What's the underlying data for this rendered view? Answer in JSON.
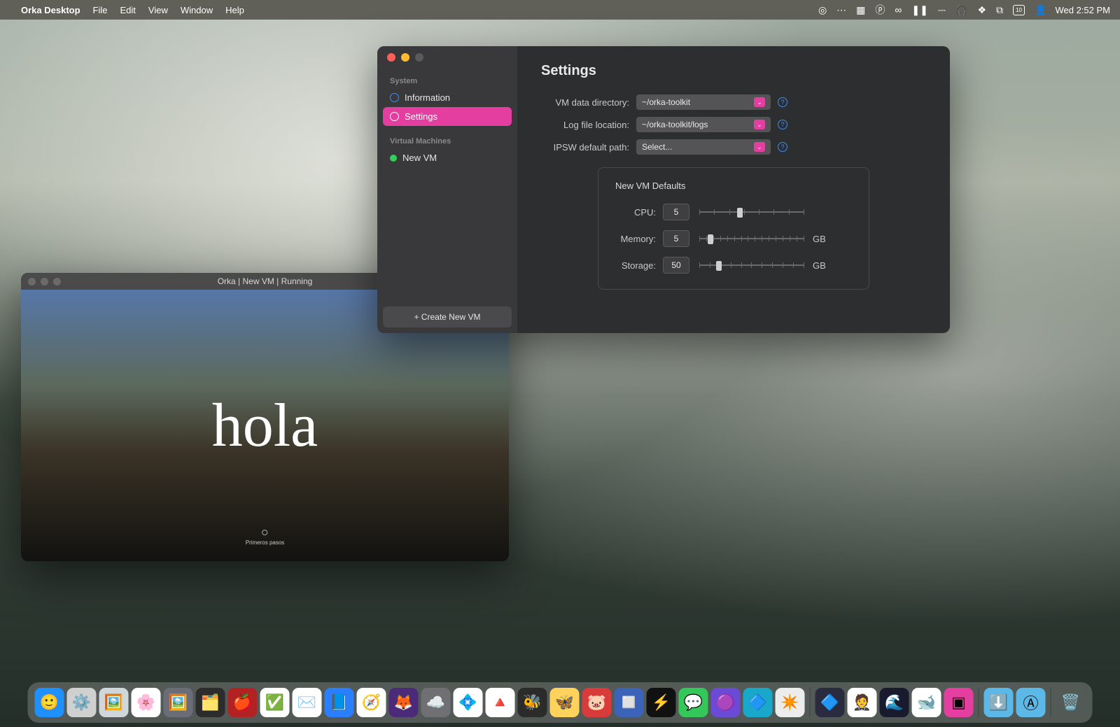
{
  "menubar": {
    "app_name": "Orka Desktop",
    "items": [
      "File",
      "Edit",
      "View",
      "Window",
      "Help"
    ],
    "calendar_day": "10",
    "datetime": "Wed 2:52 PM"
  },
  "settings_window": {
    "sidebar": {
      "section_system": "System",
      "item_information": "Information",
      "item_settings": "Settings",
      "section_vm": "Virtual Machines",
      "item_new_vm": "New VM",
      "create_button": "+ Create New VM"
    },
    "title": "Settings",
    "fields": {
      "vm_data_dir_label": "VM data directory:",
      "vm_data_dir_value": "~/orka-toolkit",
      "log_file_label": "Log file location:",
      "log_file_value": "~/orka-toolkit/logs",
      "ipsw_label": "IPSW default path:",
      "ipsw_value": "Select..."
    },
    "panel": {
      "title": "New VM Defaults",
      "cpu_label": "CPU:",
      "cpu_value": "5",
      "memory_label": "Memory:",
      "memory_value": "5",
      "memory_unit": "GB",
      "storage_label": "Storage:",
      "storage_value": "50",
      "storage_unit": "GB"
    }
  },
  "vm_window": {
    "title": "Orka | New VM | Running",
    "greeting": "hola",
    "setup_text": "Primeros pasos"
  },
  "dock_icons": [
    {
      "name": "finder",
      "bg": "#1e90ff",
      "glyph": "🙂"
    },
    {
      "name": "system-settings",
      "bg": "#d0d0d0",
      "glyph": "⚙️"
    },
    {
      "name": "preview",
      "bg": "#cfd6dc",
      "glyph": "🖼️"
    },
    {
      "name": "photos",
      "bg": "#ffffff",
      "glyph": "🌸"
    },
    {
      "name": "app-1",
      "bg": "#6a6d78",
      "glyph": "🖼️"
    },
    {
      "name": "app-2",
      "bg": "#2c2c2c",
      "glyph": "🗂️"
    },
    {
      "name": "app-3",
      "bg": "#b22222",
      "glyph": "🍎"
    },
    {
      "name": "things",
      "bg": "#ffffff",
      "glyph": "✅"
    },
    {
      "name": "mail",
      "bg": "#ffffff",
      "glyph": "✉️"
    },
    {
      "name": "app-blue",
      "bg": "#2a7fff",
      "glyph": "📘"
    },
    {
      "name": "safari",
      "bg": "#ffffff",
      "glyph": "🧭"
    },
    {
      "name": "firefox",
      "bg": "#4b2a7a",
      "glyph": "🦊"
    },
    {
      "name": "cloud",
      "bg": "#6f6f74",
      "glyph": "☁️"
    },
    {
      "name": "slack",
      "bg": "#ffffff",
      "glyph": "💠"
    },
    {
      "name": "clickup",
      "bg": "#ffffff",
      "glyph": "🔺"
    },
    {
      "name": "app-dark",
      "bg": "#2b2b2b",
      "glyph": "🐝"
    },
    {
      "name": "butterfly",
      "bg": "#ffd35b",
      "glyph": "🦋"
    },
    {
      "name": "app-red",
      "bg": "#d93a3a",
      "glyph": "🐷"
    },
    {
      "name": "app-square",
      "bg": "#3b63b8",
      "glyph": "◻️"
    },
    {
      "name": "app-bolt",
      "bg": "#111",
      "glyph": "⚡"
    },
    {
      "name": "messages",
      "bg": "#34c759",
      "glyph": "💬"
    },
    {
      "name": "app-purple",
      "bg": "#6b4bd6",
      "glyph": "🟣"
    },
    {
      "name": "app-teal",
      "bg": "#19a8c9",
      "glyph": "🔷"
    },
    {
      "name": "chatgpt",
      "bg": "#ececec",
      "glyph": "✴️"
    }
  ],
  "dock_icons2": [
    {
      "name": "proton",
      "bg": "#2b2b3f",
      "glyph": "🔷"
    },
    {
      "name": "tux",
      "bg": "#ffffff",
      "glyph": "🤵"
    },
    {
      "name": "app-night",
      "bg": "#1a1a2e",
      "glyph": "🌊"
    },
    {
      "name": "orka",
      "bg": "#ffffff",
      "glyph": "🐋"
    },
    {
      "name": "preview-open",
      "bg": "#e43fa0",
      "glyph": "▣"
    }
  ],
  "dock_icons3": [
    {
      "name": "downloads",
      "bg": "#5cb8e6",
      "glyph": "⬇️"
    },
    {
      "name": "applications",
      "bg": "#5cb8e6",
      "glyph": "Ⓐ"
    }
  ],
  "dock_icons4": [
    {
      "name": "trash",
      "bg": "transparent",
      "glyph": "🗑️"
    }
  ]
}
